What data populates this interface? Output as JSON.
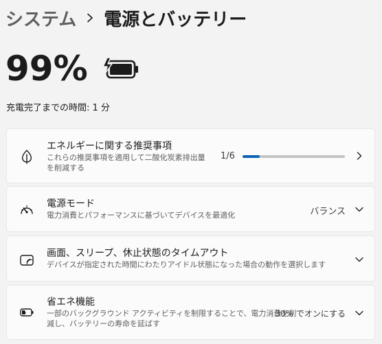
{
  "breadcrumb": {
    "parent": "システム",
    "current": "電源とバッテリー"
  },
  "battery": {
    "percent_text": "99%",
    "charge_status": "充電完了までの時間: 1 分"
  },
  "cards": {
    "energy": {
      "title": "エネルギーに関する推奨事項",
      "subtitle_line1": "これらの推奨事項を適用して二酸化炭素排出量",
      "subtitle_line2": "を削減する",
      "progress_text": "1/6",
      "progress_fraction": 0.1667
    },
    "power_mode": {
      "title": "電源モード",
      "subtitle": "電力消費とパフォーマンスに基づいてデバイスを最適化",
      "value": "バランス"
    },
    "screen_sleep": {
      "title": "画面、スリープ、休止状態のタイムアウト",
      "subtitle": "デバイスが指定された時間にわたりアイドル状態になった場合の動作を選択します"
    },
    "battery_saver": {
      "title": "省エネ機能",
      "subtitle_line1": "一部のバックグラウンド アクティビティを制限することで、電力消費を削",
      "subtitle_line2": "減し、バッテリーの寿命を延ばす",
      "value": "30% でオンにする"
    }
  },
  "colors": {
    "accent": "#0a64b8",
    "background": "#f3f3f3",
    "card": "#fbfbfb"
  }
}
